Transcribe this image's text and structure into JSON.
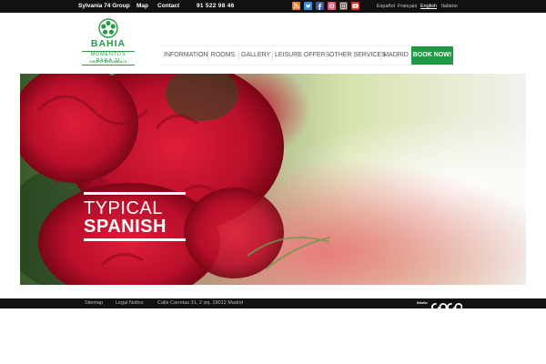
{
  "topbar": {
    "links": [
      "Sylvania 74 Group",
      "Map",
      "Contact"
    ],
    "phone": "91 522 98 46",
    "social": [
      "rss-icon",
      "twitter-icon",
      "facebook-icon",
      "foursquare-icon",
      "instagram-icon",
      "youtube-icon"
    ],
    "languages": [
      {
        "label": "Español",
        "active": false
      },
      {
        "label": "Français",
        "active": false
      },
      {
        "label": "English",
        "active": true
      },
      {
        "label": "Italiano",
        "active": false
      }
    ]
  },
  "logo": {
    "name": "BAHIA",
    "tagline": "MOMENTOS PARA TI",
    "group": "GRUPO SYLVANIA74"
  },
  "nav": {
    "items": [
      "INFORMATION",
      "ROOMS",
      "GALLERY",
      "LEISURE OFFERS",
      "OTHER SERVICES",
      "MADRID"
    ],
    "cta": "BOOK NOW!"
  },
  "hero": {
    "line1": "TYPICAL",
    "line2": "SPANISH"
  },
  "footer": {
    "links": [
      "Sitemap",
      "Legal Notice",
      "Calle Carretas 31, 2 izq. 28012 Madrid"
    ],
    "design_label": "Diseño",
    "design_brand": "coco"
  },
  "colors": {
    "brand_green": "#1f9a43",
    "bar_black": "#111111",
    "carnation_red": "#c8102e"
  }
}
